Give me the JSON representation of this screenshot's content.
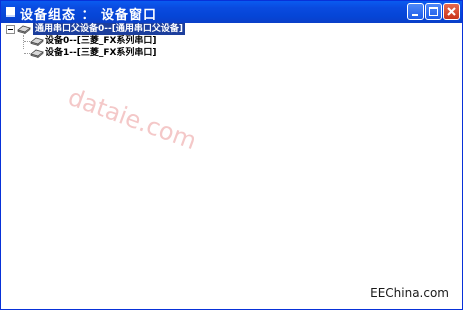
{
  "window": {
    "title": "设备组态 ： 设备窗口",
    "colors": {
      "titlebar": "#0a4be0",
      "selection": "#1c3e9c",
      "close": "#c8341a"
    }
  },
  "tree": {
    "root": {
      "label": "通用串口父设备0--[通用串口父设备]",
      "expanded": true,
      "selected": true,
      "icon": "device-icon"
    },
    "children": [
      {
        "label": "设备0--[三菱_FX系列串口]",
        "icon": "device-icon"
      },
      {
        "label": "设备1--[三菱_FX系列串口]",
        "icon": "device-icon"
      }
    ]
  },
  "watermark": "dataie.com",
  "site_logo": "EEChina.com"
}
